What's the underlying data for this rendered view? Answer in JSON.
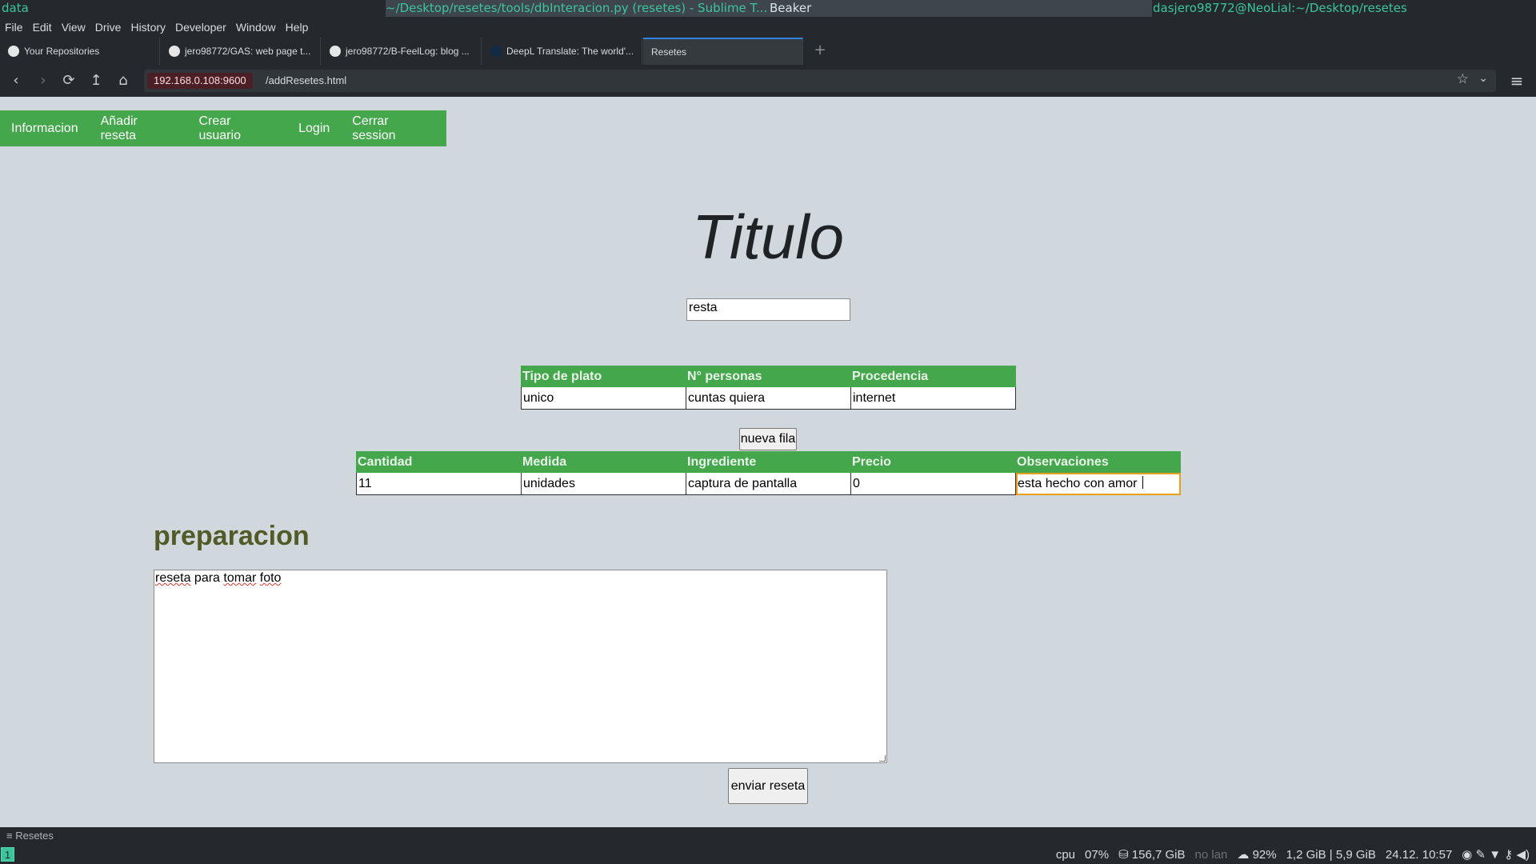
{
  "wm": {
    "left": "data",
    "title": "~/Desktop/resetes/tools/dbInteracion.py (resetes) - Sublime T...",
    "beaker": "Beaker",
    "right": "dasjero98772@NeoLial:~/Desktop/resetes"
  },
  "menu": [
    "File",
    "Edit",
    "View",
    "Drive",
    "History",
    "Developer",
    "Window",
    "Help"
  ],
  "tabs": [
    {
      "label": "Your Repositories",
      "icon": "github-icon"
    },
    {
      "label": "jero98772/GAS: web page t...",
      "icon": "github-icon"
    },
    {
      "label": "jero98772/B-FeelLog: blog ...",
      "icon": "github-icon"
    },
    {
      "label": "DeepL Translate: The world'...",
      "icon": "deepl-icon"
    },
    {
      "label": "Resetes",
      "icon": ""
    }
  ],
  "tab_add": "+",
  "nav": {
    "back": "‹",
    "forward": "›",
    "reload": "⟳",
    "up": "↥",
    "home": "⌂",
    "menu": "≡"
  },
  "url": {
    "host": "192.168.0.108:9600",
    "path": "/addResetes.html",
    "star": "☆",
    "dropdown": "⌄"
  },
  "site_nav": [
    "Informacion",
    "Añadir reseta",
    "Crear usuario",
    "Login",
    "Cerrar session"
  ],
  "page": {
    "title": "Titulo",
    "title_value": "resta",
    "info_table": {
      "headers": [
        "Tipo de plato",
        "N° personas",
        "Procedencia"
      ],
      "row": [
        "unico",
        "cuntas quiera",
        "internet"
      ]
    },
    "new_row_label": "nueva fila",
    "ingredients_table": {
      "headers": [
        "Cantidad",
        "Medida",
        "Ingrediente",
        "Precio",
        "Observaciones"
      ],
      "row": [
        "11",
        "unidades",
        "captura de pantalla",
        "0",
        "esta hecho con amor "
      ]
    },
    "prep_heading": "preparacion",
    "prep_words": [
      "reseta",
      " para ",
      "tomar",
      " ",
      "foto"
    ],
    "send_label": "enviar reseta"
  },
  "beaker_status": "≡ Resetes",
  "i3bar": {
    "workspace": "1",
    "cpu_label": "cpu",
    "cpu": "07%",
    "disk": "⛁ 156,7 GiB",
    "lan": "no lan",
    "battery": "92%",
    "mem": "1,2 GiB | 5,9 GiB",
    "datetime": "24.12. 10:57"
  },
  "colors": {
    "accent_green": "#44a74c",
    "wm_teal": "#3cc59c",
    "heading_olive": "#525b28"
  }
}
